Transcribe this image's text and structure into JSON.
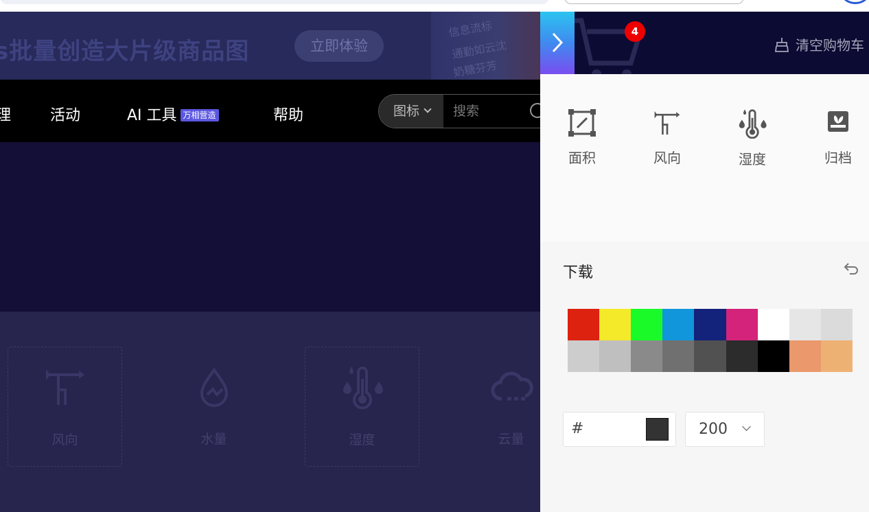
{
  "banner": {
    "headline": "s批量创造大片级商品图",
    "cta_label": "立即体验",
    "art_lines": [
      "信息流标",
      "通勤如云沈",
      "奶糖芬芳"
    ]
  },
  "nav": {
    "items": [
      {
        "label": "理"
      },
      {
        "label": "活动"
      },
      {
        "label": "AI 工具"
      },
      {
        "label": "帮助"
      }
    ],
    "ai_badge": "万相营造",
    "search": {
      "type_label": "图标",
      "placeholder": "搜索"
    }
  },
  "icon_grid": [
    {
      "label": "风向",
      "icon": "wind-vane-icon",
      "dashed": true
    },
    {
      "label": "水量",
      "icon": "water-drop-icon",
      "dashed": false
    },
    {
      "label": "湿度",
      "icon": "humidity-thermometer-icon",
      "dashed": true
    },
    {
      "label": "云量",
      "icon": "cloud-icon",
      "dashed": false
    }
  ],
  "cart_panel": {
    "badge_count": "4",
    "clear_label": "清空购物车",
    "items": [
      {
        "label": "面积",
        "icon": "area-icon"
      },
      {
        "label": "风向",
        "icon": "wind-vane-icon"
      },
      {
        "label": "湿度",
        "icon": "humidity-thermometer-icon"
      },
      {
        "label": "归档",
        "icon": "archive-icon"
      }
    ],
    "download_title": "下载",
    "palette": [
      "#dd2210",
      "#f4ea2a",
      "#1afa29",
      "#1296db",
      "#13227a",
      "#d4237a",
      "#ffffff",
      "#e6e6e6",
      "#dbdbdb",
      "#cdcdcd",
      "#bfbfbf",
      "#8a8a8a",
      "#707070",
      "#515151",
      "#2c2c2c",
      "#000000",
      "#ea986c",
      "#eeb174"
    ],
    "hex_label": "#",
    "preview_color": "#333333",
    "size_value": "200"
  }
}
